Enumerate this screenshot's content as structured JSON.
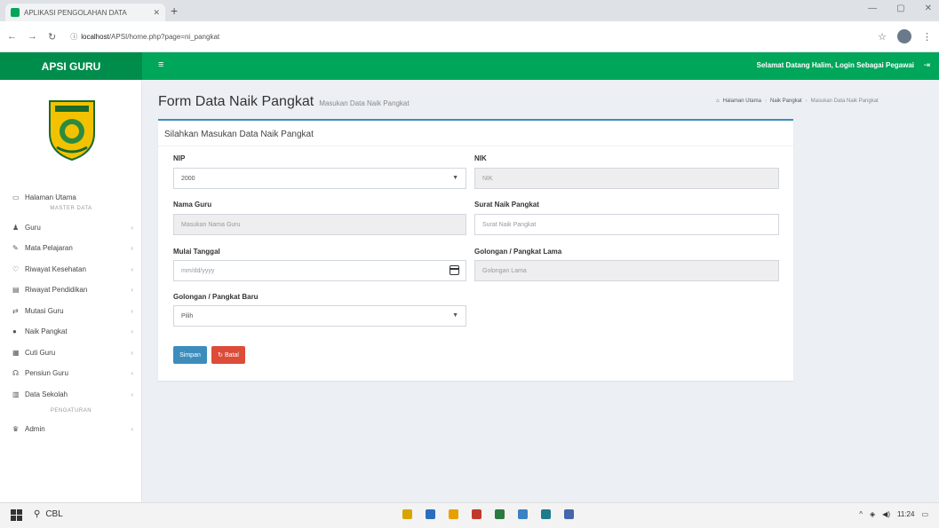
{
  "browser": {
    "tab_title": "APLIKASI PENGOLAHAN DATA",
    "new_tab": "+",
    "url_domain": "localhost",
    "url_path": "/APSI/home.php?page=ni_pangkat",
    "window_controls": [
      "—",
      "▢",
      "✕"
    ]
  },
  "header": {
    "brand": "APSI GURU",
    "menu_icon": "≡",
    "welcome": "Selamat Datang Halim, Login Sebagai Pegawai",
    "signout_icon": "⇥"
  },
  "sidebar": {
    "items": [
      {
        "icon": "▭",
        "label": "Halaman Utama"
      },
      {
        "header": "MASTER DATA"
      },
      {
        "icon": "♟",
        "label": "Guru"
      },
      {
        "icon": "✎",
        "label": "Mata Pelajaran"
      },
      {
        "icon": "♡",
        "label": "Riwayat Kesehatan"
      },
      {
        "icon": "▤",
        "label": "Riwayat Pendidikan"
      },
      {
        "icon": "⇄",
        "label": "Mutasi Guru"
      },
      {
        "icon": "●",
        "label": "Naik Pangkat"
      },
      {
        "icon": "▦",
        "label": "Cuti Guru"
      },
      {
        "icon": "☊",
        "label": "Pensiun Guru"
      },
      {
        "icon": "▥",
        "label": "Data Sekolah"
      },
      {
        "header": "PENGATURAN"
      },
      {
        "icon": "♛",
        "label": "Admin"
      }
    ],
    "chevron": "‹"
  },
  "content": {
    "title": "Form Data Naik Pangkat",
    "subtitle": "Masukan Data Naik Pangkat",
    "breadcrumb": [
      "Halaman Utama",
      "Naik Pangkat",
      "Masukan Data Naik Pangkat"
    ],
    "box_title": "Silahkan Masukan Data Naik Pangkat"
  },
  "form": {
    "nip_label": "NIP",
    "nip_value": "2000",
    "nik_label": "NIK",
    "nik_value": "NIK",
    "nama_label": "Nama Guru",
    "nama_placeholder": "Masukan Nama Guru",
    "surat_label": "Surat Naik Pangkat",
    "surat_placeholder": "Surat Naik Pangkat",
    "mulai_label": "Mulai Tanggal",
    "mulai_placeholder": "mm/dd/yyyy",
    "lama_label": "Golongan / Pangkat Lama",
    "lama_placeholder": "Golongan Lama",
    "baru_label": "Golongan / Pangkat Baru",
    "baru_value": "Pilih",
    "save_label": "Simpan",
    "reset_label": "Batal"
  },
  "taskbar": {
    "search_text": "CBL",
    "time": "11:24",
    "app_colors": [
      "#d9a400",
      "#2a6fbf",
      "#e8a000",
      "#c0392b",
      "#2c7a3f",
      "#3b82c4",
      "#1e7b8a",
      "#4466aa"
    ]
  }
}
